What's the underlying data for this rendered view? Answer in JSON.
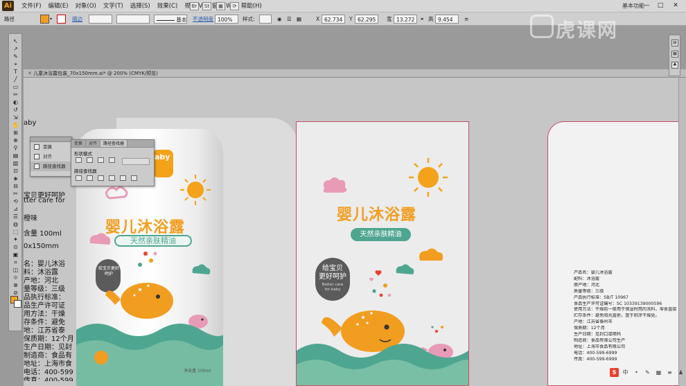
{
  "app": {
    "logo": "Ai",
    "workspace": "基本功能"
  },
  "menus": [
    "文件(F)",
    "编辑(E)",
    "对象(O)",
    "文字(T)",
    "选择(S)",
    "效果(C)",
    "视图(V)",
    "窗口(W)",
    "帮助(H)"
  ],
  "control_bar": {
    "selection_label": "路径",
    "brush_label": "描边",
    "stroke_weight": "",
    "stroke_profile": "等比",
    "brush_style": "基本",
    "opacity_link": "不透明度",
    "opacity_value": "100%",
    "style_label": "样式:",
    "x_label": "X",
    "x_value": "62.734",
    "y_label": "Y",
    "y_value": "62.295",
    "w_label": "宽",
    "w_value": "13.272",
    "h_label": "高",
    "h_value": "9.454"
  },
  "document": {
    "tab": "儿童沐浴露包装_70x150mm.ai* @ 200% (CMYK/预览)"
  },
  "panels": {
    "transform_list": [
      "变换",
      "对齐",
      "路径查找器"
    ],
    "pathfinder_tabs": [
      "变换",
      "对齐",
      "路径查找器"
    ],
    "shape_modes": "形状模式",
    "pathfinders": "路径查找器",
    "expand": ""
  },
  "left_text_layers": [
    "aby",
    "宝贝更好呵护",
    "tter care for",
    "橙味",
    "含量 100ml",
    "0x150mm",
    "名：婴儿沐浴",
    "料：沐浴露",
    "产地：河北",
    "量等级：三级",
    "品执行标准：",
    "品生产许可证",
    "用方法：干燥",
    "存条件：避免",
    "地：江苏省泰",
    "保质期：12个月",
    "生产日期：见封",
    "制造商：食品有",
    "地址：上海市食",
    "电话：400-599",
    "传真：400-599"
  ],
  "bottle": {
    "badge": "aby",
    "title": "婴儿沐浴露",
    "pill": "天然亲肤精油",
    "badge_main": "给宝贝更好呵护",
    "net": "净含量 100ml"
  },
  "front_label": {
    "title": "婴儿沐浴露",
    "pill": "天然亲肤精油",
    "badge_line1": "给宝贝",
    "badge_line2": "更好呵护",
    "badge_line3": "Better care",
    "badge_line4": "for baby"
  },
  "back_label": {
    "lines": [
      "产品名：婴儿沐浴露",
      "配料：沐浴露",
      "原产地：河北",
      "质量等级：三级",
      "产品执行标准：SB/T 10967",
      "食品生产许可证编号：SC 10339139000596",
      "使用方法：干燥前一般用于保湿时用的洗料，零食直接",
      "贮存条件：避免阳光直射，置于阴凉干燥处。",
      "产地：江苏省泰州市",
      "保质期：12个月",
      "生产日期：见封口或喷码",
      "制造商：食品有限公司生产",
      "地址：上海市食品有限公司",
      "电话：400-599-6999",
      "传真：400-599-6999"
    ]
  },
  "watermark": "虎课网",
  "tray": [
    "S",
    "中",
    "•",
    "✎",
    "▦",
    "≡",
    "♟",
    "▣"
  ],
  "colors": {
    "orange": "#f19d20",
    "teal": "#4fa690",
    "pink": "#e89bb6",
    "artboard_border": "#c84a68"
  }
}
